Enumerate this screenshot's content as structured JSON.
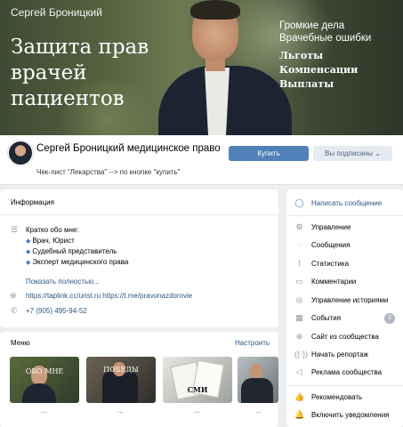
{
  "cover": {
    "top_name": "Сергей Броницкий",
    "title_lines": [
      "Защита прав",
      "врачей",
      "пациентов"
    ],
    "right_lines": [
      "Громкие дела",
      "Врачебные ошибки"
    ],
    "right_serif": [
      "Льготы",
      "Компенсации",
      "Выплаты"
    ]
  },
  "profile": {
    "name": "Сергей Броницкий медицинское право",
    "status": "Чек-лист \"Лекарства\" --> по кнопке \"купить\"",
    "buy_label": "Купить",
    "subscribed_label": "Вы подписаны ⌄"
  },
  "info": {
    "heading": "Информация",
    "about_intro": "Кратко обо мне:",
    "about_items": [
      "Врач, Юрист",
      "Судебный представитель",
      "Эксперт медицинского права"
    ],
    "more_label": "Показать полностью...",
    "links": "https://taplink.cc/urist.ru https://t.me/pravonazdorovie",
    "phone": "+7 (905) 495-94-52"
  },
  "menu": {
    "heading": "Меню",
    "setup_label": "Настроить",
    "items": [
      {
        "label": "ОБО МНЕ",
        "dots": "..."
      },
      {
        "label": "ПОБЕДЫ",
        "dots": "..."
      },
      {
        "label": "СМИ",
        "dots": "..."
      },
      {
        "label": "",
        "dots": "..."
      }
    ]
  },
  "sidebar": {
    "write_message": "Написать сообщение",
    "items": [
      {
        "label": "Управление",
        "icon": "gear-icon"
      },
      {
        "label": "Сообщения",
        "icon": "chat-icon"
      },
      {
        "label": "Статистика",
        "icon": "stats-icon"
      },
      {
        "label": "Комментарии",
        "icon": "comments-icon"
      },
      {
        "label": "Управление историями",
        "icon": "stories-icon"
      },
      {
        "label": "События",
        "icon": "events-icon",
        "badge": "3"
      },
      {
        "label": "Сайт из сообщества",
        "icon": "globe-icon"
      },
      {
        "label": "Начать репортаж",
        "icon": "broadcast-icon"
      },
      {
        "label": "Реклама сообщества",
        "icon": "megaphone-icon"
      }
    ],
    "recommend": "Рекомендовать",
    "notifications": "Включить уведомления"
  },
  "colors": {
    "accent": "#5181b8",
    "link": "#2a5885",
    "background": "#edeef0"
  }
}
